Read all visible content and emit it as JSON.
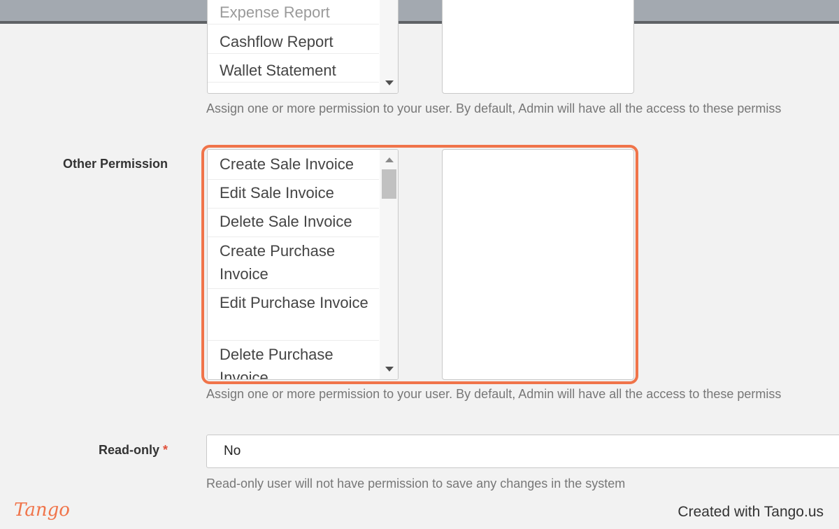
{
  "report_permissions": {
    "options": [
      "Expense Report",
      "Cashflow Report",
      "Wallet Statement"
    ],
    "help": "Assign one or more permission to your user. By default, Admin will have all the access to these permiss"
  },
  "other_permission": {
    "label": "Other Permission",
    "options": [
      "Create Sale Invoice",
      "Edit Sale Invoice",
      "Delete Sale Invoice",
      "Create Purchase Invoice",
      "Edit Purchase Invoice",
      "Delete Purchase Invoice"
    ],
    "help": "Assign one or more permission to your user. By default, Admin will have all the access to these permiss"
  },
  "read_only": {
    "label": "Read-only",
    "required_mark": "*",
    "value": "No",
    "help": "Read-only user will not have permission to save any changes in the system"
  },
  "footer": {
    "logo": "Tango",
    "credit": "Created with Tango.us"
  },
  "colors": {
    "highlight": "#f0744a",
    "required": "#e0503a"
  }
}
